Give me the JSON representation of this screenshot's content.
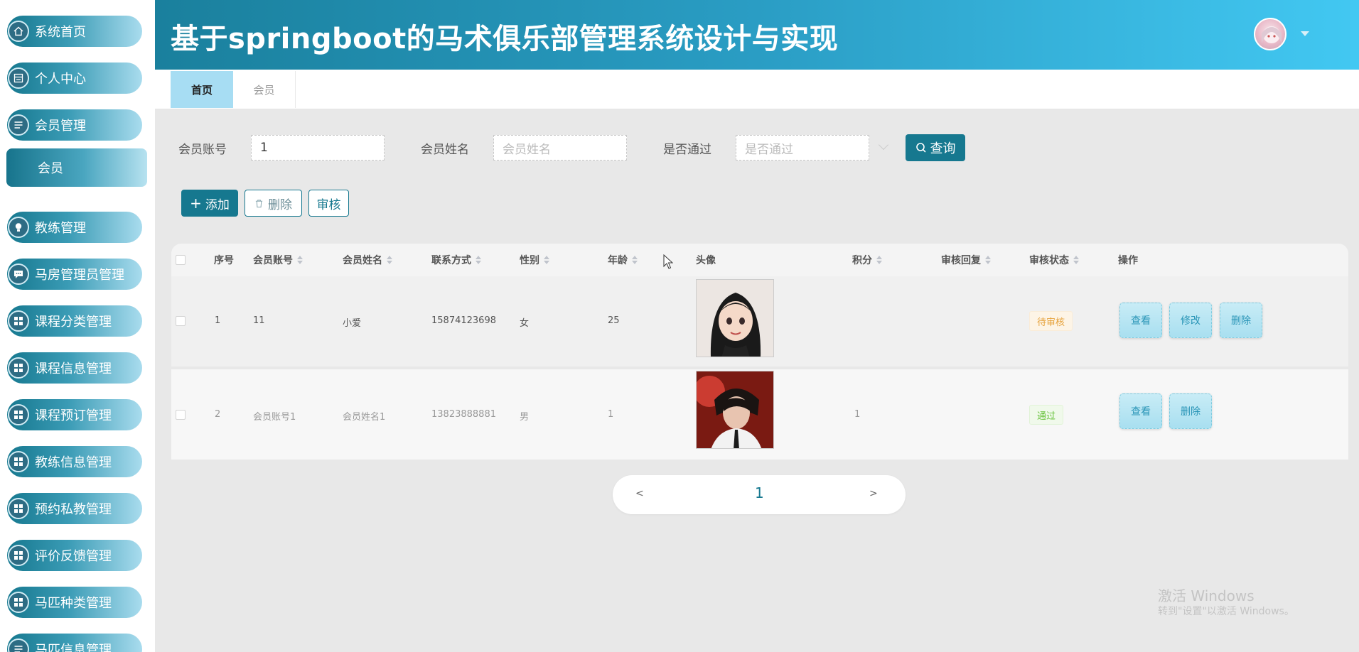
{
  "app": {
    "title": "基于springboot的马术俱乐部管理系统设计与实现"
  },
  "sidebar": {
    "items": [
      {
        "label": "系统首页",
        "icon": "home-icon"
      },
      {
        "label": "个人中心",
        "icon": "card-icon"
      },
      {
        "label": "会员管理",
        "icon": "list-icon"
      },
      {
        "label": "教练管理",
        "icon": "bulb-icon"
      },
      {
        "label": "马房管理员管理",
        "icon": "chat-icon"
      },
      {
        "label": "课程分类管理",
        "icon": "grid-icon"
      },
      {
        "label": "课程信息管理",
        "icon": "grid-icon"
      },
      {
        "label": "课程预订管理",
        "icon": "grid-icon"
      },
      {
        "label": "教练信息管理",
        "icon": "grid-icon"
      },
      {
        "label": "预约私教管理",
        "icon": "grid-icon"
      },
      {
        "label": "评价反馈管理",
        "icon": "grid-icon"
      },
      {
        "label": "马匹种类管理",
        "icon": "grid-icon"
      },
      {
        "label": "马匹信息管理",
        "icon": "list-icon"
      }
    ],
    "sub_item": "会员"
  },
  "tabs": [
    {
      "label": "首页"
    },
    {
      "label": "会员"
    }
  ],
  "search": {
    "account_label": "会员账号",
    "account_value": "1",
    "name_label": "会员姓名",
    "name_placeholder": "会员姓名",
    "pass_label": "是否通过",
    "pass_placeholder": "是否通过",
    "query_button": "查询"
  },
  "actions": {
    "add": "添加",
    "delete": "删除",
    "audit": "审核"
  },
  "table": {
    "headers": [
      "序号",
      "会员账号",
      "会员姓名",
      "联系方式",
      "性别",
      "年龄",
      "头像",
      "积分",
      "审核回复",
      "审核状态",
      "操作"
    ],
    "rows": [
      {
        "index": "1",
        "account": "11",
        "name": "小爱",
        "phone": "15874123698",
        "gender": "女",
        "age": "25",
        "points": "",
        "reply": "",
        "status": "待审核",
        "ops": [
          "查看",
          "修改",
          "删除"
        ]
      },
      {
        "index": "2",
        "account": "会员账号1",
        "name": "会员姓名1",
        "phone": "13823888881",
        "gender": "男",
        "age": "1",
        "points": "1",
        "reply": "",
        "status": "通过",
        "ops": [
          "查看",
          "删除"
        ]
      }
    ]
  },
  "pagination": {
    "prev": "<",
    "page": "1",
    "next": ">"
  },
  "watermark": {
    "line1": "激活 Windows",
    "line2": "转到\"设置\"以激活 Windows。"
  },
  "colors": {
    "accent": "#16788f",
    "header_start": "#1a809d",
    "header_end": "#42c8f2"
  }
}
